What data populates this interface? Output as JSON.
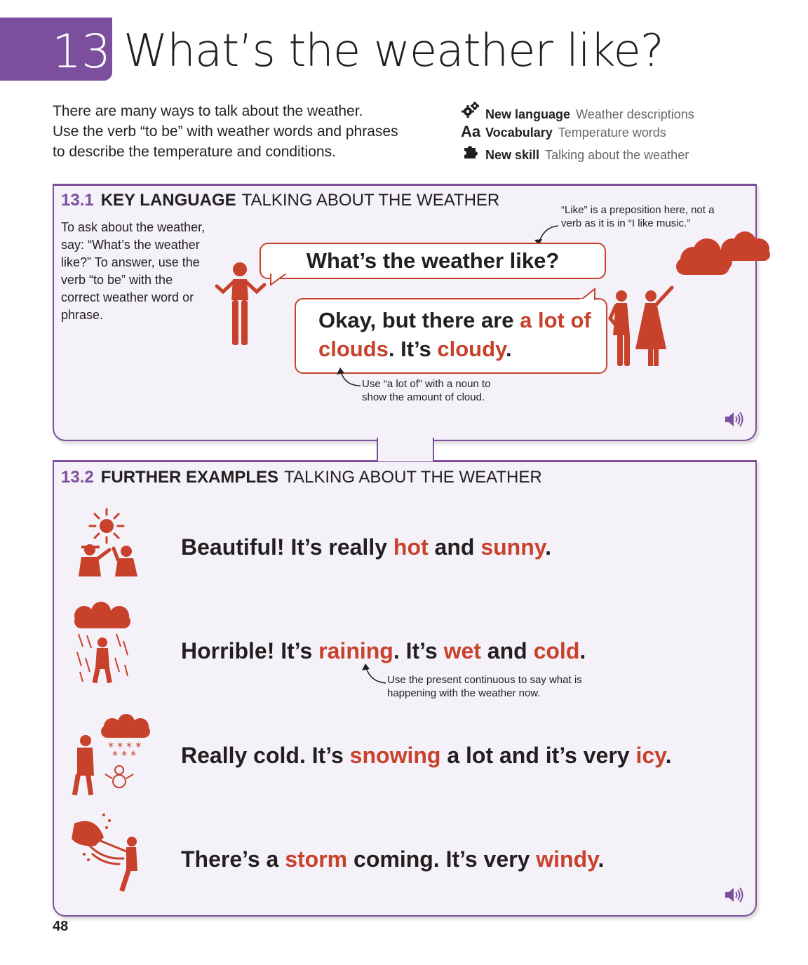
{
  "header": {
    "chapter_number": "13",
    "title": "What’s the weather like?",
    "intro_lines": [
      "There are many ways to talk about the weather.",
      "Use the verb “to be” with weather words and phrases",
      "to describe the temperature and conditions."
    ]
  },
  "meta": [
    {
      "icon": "gears-icon",
      "label": "New language",
      "value": "Weather descriptions"
    },
    {
      "icon": "aa-icon",
      "glyph": "Aa",
      "label": "Vocabulary",
      "value": "Temperature words"
    },
    {
      "icon": "puzzle-icon",
      "label": "New skill",
      "value": "Talking about the weather"
    }
  ],
  "section1": {
    "number": "13.1",
    "heading_bold": "KEY LANGUAGE",
    "heading_rest": "TALKING ABOUT THE WEATHER",
    "side_note": "To ask about the weather, say: “What’s the weather like?” To answer, use the verb “to be” with the correct weather word or phrase.",
    "question": "What’s the weather like?",
    "answer_parts": [
      {
        "text": "Okay, but there are ",
        "highlight": false
      },
      {
        "text": "a lot of clouds",
        "highlight": true
      },
      {
        "text": ". It’s ",
        "highlight": false
      },
      {
        "text": "cloudy",
        "highlight": true
      },
      {
        "text": ".",
        "highlight": false
      }
    ],
    "note_like": "“Like” is a preposition here, not a verb as it is in “I like music.”",
    "note_a_lot": "Use “a lot of” with a noun to show the amount of cloud."
  },
  "section2": {
    "number": "13.2",
    "heading_bold": "FURTHER EXAMPLES",
    "heading_rest": "TALKING ABOUT THE WEATHER",
    "examples": [
      {
        "icon": "sunny-people-icon",
        "parts": [
          {
            "text": "Beautiful! It’s really ",
            "highlight": false
          },
          {
            "text": "hot",
            "highlight": true
          },
          {
            "text": " and ",
            "highlight": false
          },
          {
            "text": "sunny",
            "highlight": true
          },
          {
            "text": ".",
            "highlight": false
          }
        ]
      },
      {
        "icon": "rain-person-icon",
        "parts": [
          {
            "text": "Horrible! It’s ",
            "highlight": false
          },
          {
            "text": "raining",
            "highlight": true
          },
          {
            "text": ". It’s ",
            "highlight": false
          },
          {
            "text": "wet",
            "highlight": true
          },
          {
            "text": " and ",
            "highlight": false
          },
          {
            "text": "cold",
            "highlight": true
          },
          {
            "text": ".",
            "highlight": false
          }
        ]
      },
      {
        "icon": "snow-person-icon",
        "parts": [
          {
            "text": "Really cold. It’s ",
            "highlight": false
          },
          {
            "text": "snowing",
            "highlight": true
          },
          {
            "text": " a lot and it’s very ",
            "highlight": false
          },
          {
            "text": "icy",
            "highlight": true
          },
          {
            "text": ".",
            "highlight": false
          }
        ]
      },
      {
        "icon": "storm-umbrella-icon",
        "parts": [
          {
            "text": "There’s a ",
            "highlight": false
          },
          {
            "text": "storm",
            "highlight": true
          },
          {
            "text": " coming. It’s very ",
            "highlight": false
          },
          {
            "text": "windy",
            "highlight": true
          },
          {
            "text": ".",
            "highlight": false
          }
        ]
      }
    ],
    "note_continuous": "Use the present continuous to say what is happening with the weather now."
  },
  "page_number": "48",
  "colors": {
    "accent": "#7b4f9d",
    "highlight": "#c8412b",
    "panel_bg": "#f4f1f8"
  }
}
